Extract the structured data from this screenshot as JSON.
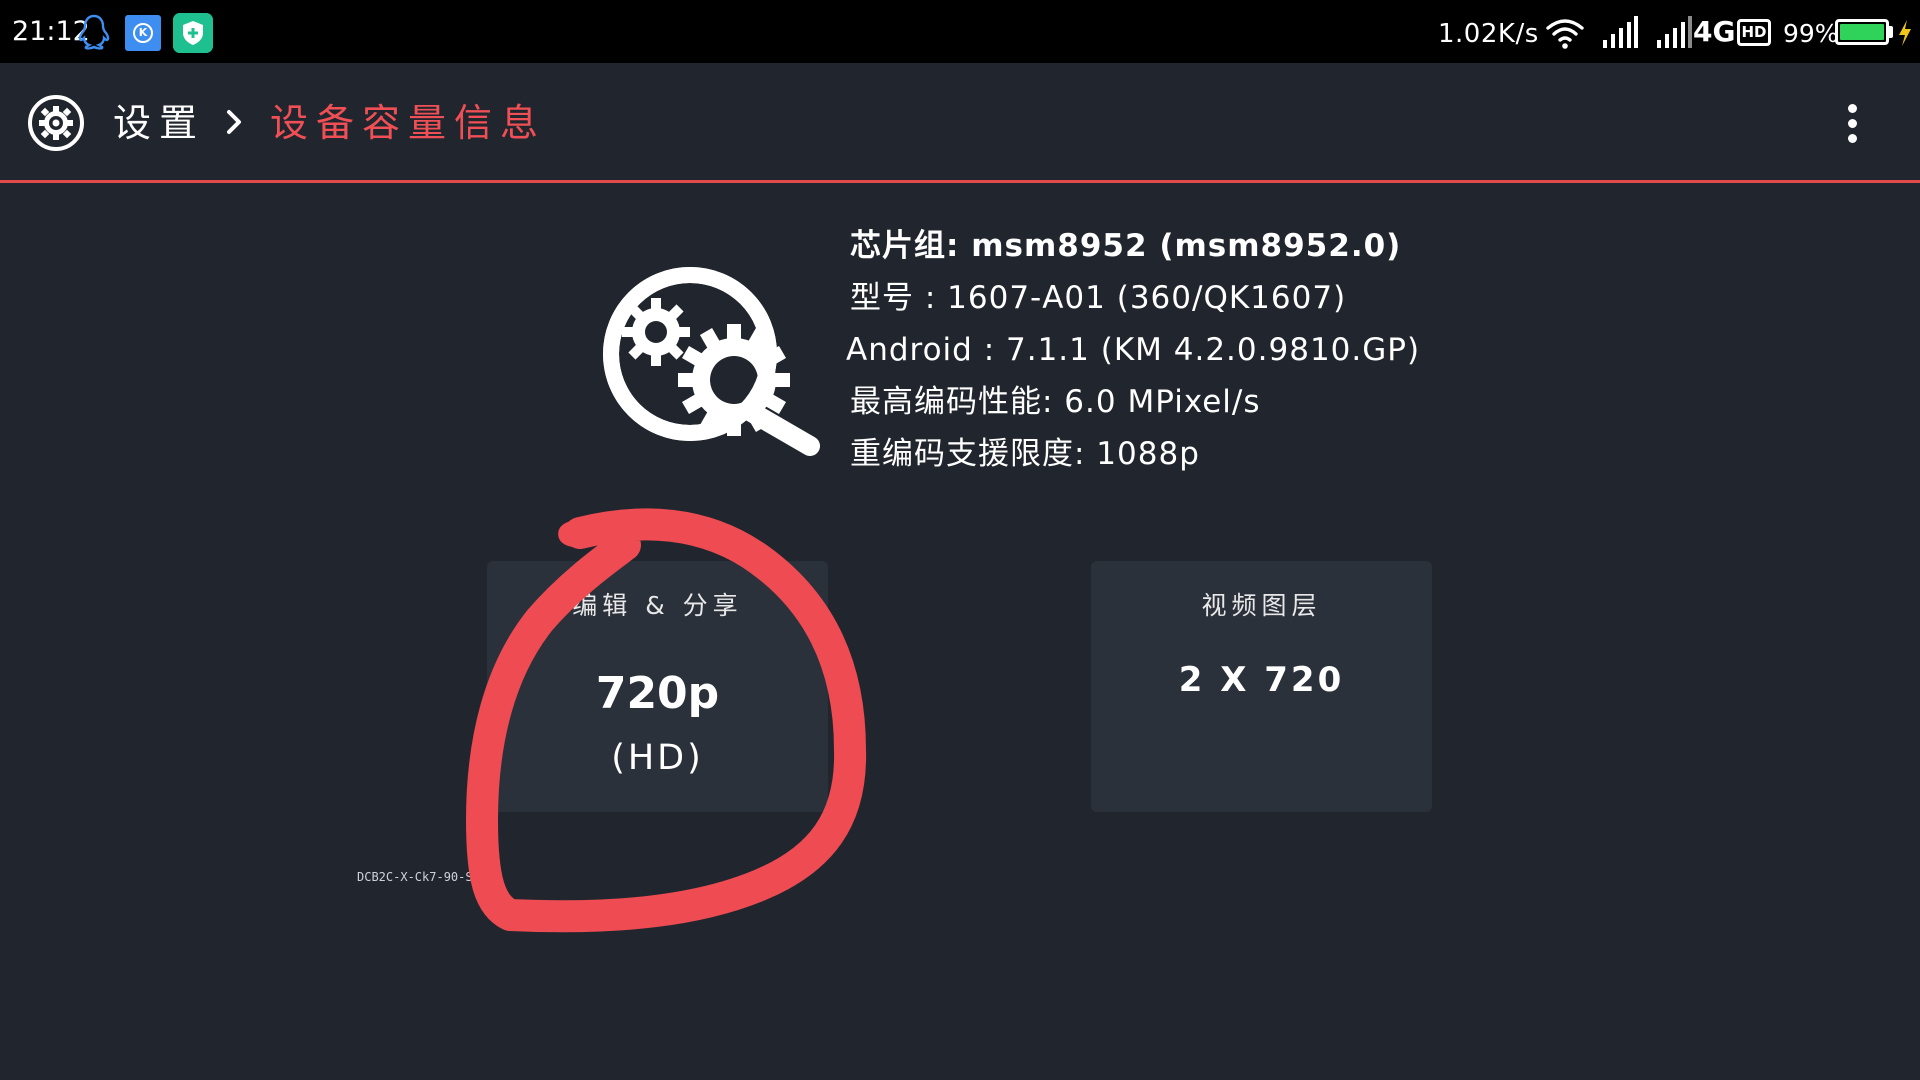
{
  "status_bar": {
    "time": "21:12",
    "net_speed": "1.02K/s",
    "network_type": "4G",
    "hd_label": "HD",
    "battery_percent": "99%",
    "battery_level": 0.99,
    "icons": [
      "qq-icon",
      "kugou-icon",
      "security-shield-icon",
      "wifi-icon",
      "signal-icon",
      "signal-icon",
      "battery-icon",
      "charging-icon"
    ]
  },
  "app_bar": {
    "breadcrumb_root": "设置",
    "breadcrumb_separator_icon": "chevron-right-icon",
    "title": "设备容量信息",
    "accent_color": "#ef4f55",
    "overflow_icon": "more-vert-icon"
  },
  "device_info": {
    "icon": "magnifier-gear-icon",
    "chipset": "芯片组: msm8952 (msm8952.0)",
    "model": "型号 :  1607-A01 (360/QK1607)",
    "android": "Android :  7.1.1 (KM 4.2.0.9810.GP)",
    "max_encode": "最高编码性能: 6.0 MPixel/s",
    "reencode_limit": "重编码支援限度: 1088p"
  },
  "cards": {
    "edit_share": {
      "title": "编辑 & 分享",
      "value": "720p",
      "sub": "(HD)"
    },
    "video_layers": {
      "title": "视频图层",
      "value": "2 X 720"
    }
  },
  "build_id": "DCB2C-X-Ck7-90-S2",
  "annotation": {
    "shape": "hand-drawn circle",
    "color": "#ee4b52"
  }
}
